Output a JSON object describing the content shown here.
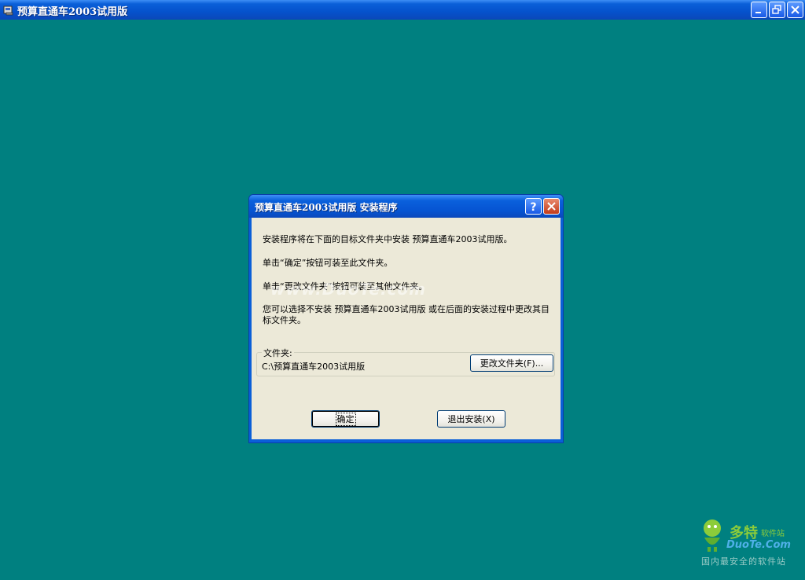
{
  "window": {
    "title": "预算直通车2003试用版"
  },
  "dialog": {
    "title": "预算直通车2003试用版 安装程序",
    "line1": "安装程序将在下面的目标文件夹中安装 预算直通车2003试用版。",
    "line2": "单击“确定”按钮可装至此文件夹。",
    "line3": "单击“更改文件夹”按钮可装至其他文件夹。",
    "line4": "您可以选择不安装 预算直通车2003试用版 或在后面的安装过程中更改其目标文件夹。",
    "folder_label": "文件夹:",
    "folder_path": "C:\\预算直通车2003试用版",
    "change_button": "更改文件夹(F)...",
    "ok_button": "确定",
    "exit_button": "退出安装(X)"
  },
  "watermark": {
    "url": "www.DuoTe.com",
    "brand": "多特",
    "brand_sub": "软件站",
    "domain": "DuoTe.Com",
    "slogan": "国内最安全的软件站"
  },
  "colors": {
    "desktop": "#008080",
    "titlebar": "#0a5fd8",
    "dialog_face": "#ece9d8",
    "close_button": "#c43b1a"
  },
  "icons": {
    "app": "installer-app-icon",
    "minimize": "minimize-icon",
    "restore": "restore-icon",
    "help": "help-icon",
    "close": "close-icon"
  }
}
